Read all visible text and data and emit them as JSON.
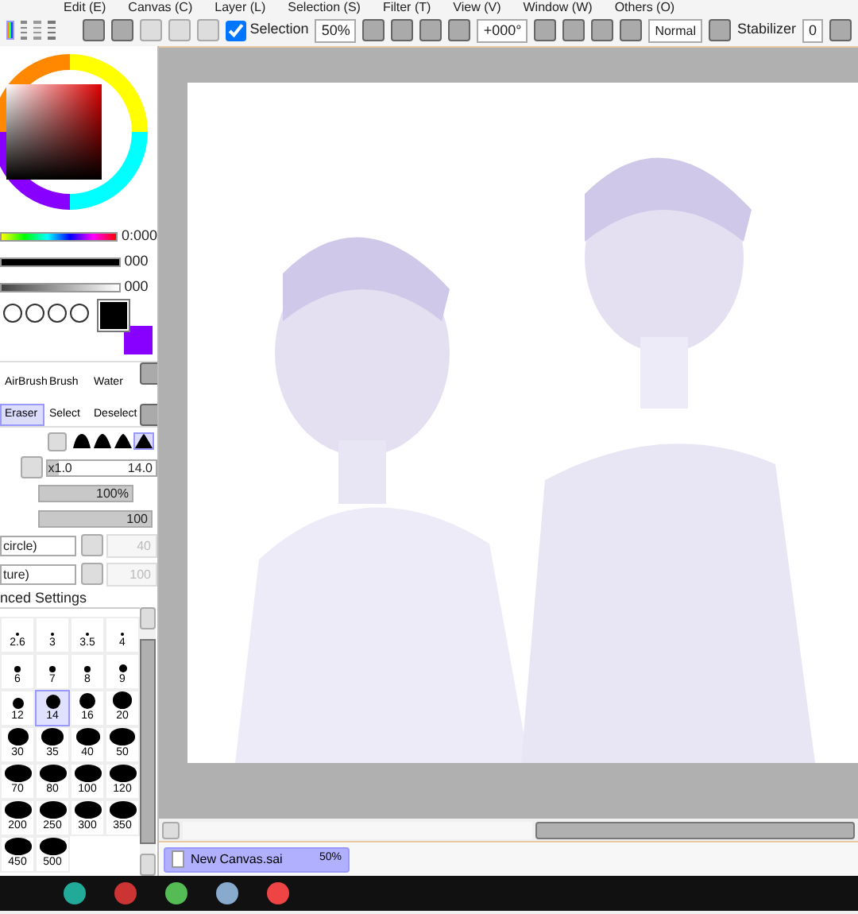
{
  "menu": [
    "Edit (E)",
    "Canvas (C)",
    "Layer (L)",
    "Selection (S)",
    "Filter (T)",
    "View (V)",
    "Window (W)",
    "Others (O)"
  ],
  "toolbar": {
    "selection": {
      "label": "Selection",
      "checked": true
    },
    "zoom": "50%",
    "rotation": "+000°",
    "blend": "Normal",
    "stabilizer_label": "Stabilizer",
    "stabilizer": "0"
  },
  "color_panel": {
    "readings": [
      "0:000",
      "000",
      "000"
    ]
  },
  "tools": [
    {
      "label": "AirBrush",
      "selected": false
    },
    {
      "label": "Brush",
      "selected": false
    },
    {
      "label": "Water",
      "selected": false
    },
    {
      "label": "Eraser",
      "selected": true
    },
    {
      "label": "Select",
      "selected": false
    },
    {
      "label": "Deselect",
      "selected": false
    }
  ],
  "brush_shapes": [
    {
      "selected": false
    },
    {
      "selected": false
    },
    {
      "selected": false
    },
    {
      "selected": true
    }
  ],
  "brush": {
    "size": {
      "multiplier": "x1.0",
      "value": "14.0",
      "level": 0.1
    },
    "density": {
      "value": "100%",
      "level": 1.0
    },
    "min_size": {
      "value": "100",
      "level": 1.0
    },
    "shape": {
      "value": "circle)",
      "amount": "40",
      "disabled": true
    },
    "texture": {
      "value": "ture)",
      "amount": "100",
      "disabled": true
    },
    "advanced": "nced Settings"
  },
  "brush_sizes": [
    {
      "label": "2.6",
      "selected": false
    },
    {
      "label": "3",
      "selected": false
    },
    {
      "label": "3.5",
      "selected": false
    },
    {
      "label": "4",
      "selected": false
    },
    {
      "label": "6",
      "selected": false
    },
    {
      "label": "7",
      "selected": false
    },
    {
      "label": "8",
      "selected": false
    },
    {
      "label": "9",
      "selected": false
    },
    {
      "label": "12",
      "selected": false
    },
    {
      "label": "14",
      "selected": true
    },
    {
      "label": "16",
      "selected": false
    },
    {
      "label": "20",
      "selected": false
    },
    {
      "label": "30",
      "selected": false
    },
    {
      "label": "35",
      "selected": false
    },
    {
      "label": "40",
      "selected": false
    },
    {
      "label": "50",
      "selected": false
    },
    {
      "label": "70",
      "selected": false
    },
    {
      "label": "80",
      "selected": false
    },
    {
      "label": "100",
      "selected": false
    },
    {
      "label": "120",
      "selected": false
    },
    {
      "label": "200",
      "selected": false
    },
    {
      "label": "250",
      "selected": false
    },
    {
      "label": "300",
      "selected": false
    },
    {
      "label": "350",
      "selected": false
    },
    {
      "label": "450",
      "selected": false
    },
    {
      "label": "500",
      "selected": false
    }
  ],
  "document_tabs": [
    {
      "title": "New Canvas.sai",
      "zoom": "50%",
      "selected": true
    }
  ]
}
